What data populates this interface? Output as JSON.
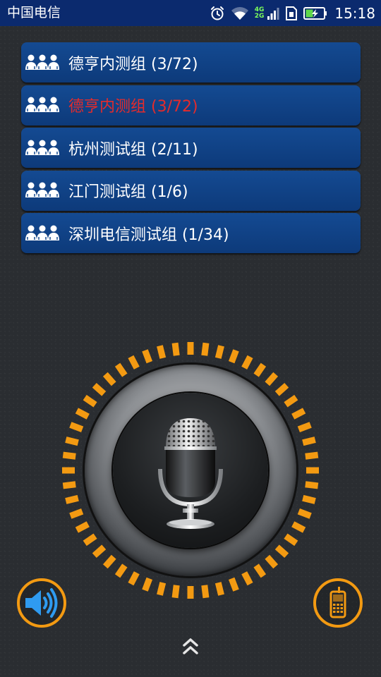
{
  "status_bar": {
    "carrier": "中国电信",
    "network_top": "4G",
    "network_bottom": "2G",
    "time": "15:18",
    "icons": [
      "alarm-icon",
      "wifi-icon",
      "signal-icon",
      "sim-icon",
      "battery-charging-icon"
    ]
  },
  "groups": [
    {
      "label": "德亨内测组 (3/72)",
      "icon": "group-icon",
      "active": false
    },
    {
      "label": "德亨内测组 (3/72)",
      "icon": "group-icon",
      "active": true
    },
    {
      "label": "杭州测试组 (2/11)",
      "icon": "group-icon",
      "active": false
    },
    {
      "label": "江门测试组 (1/6)",
      "icon": "group-icon",
      "active": false
    },
    {
      "label": "深圳电信测试组 (1/34)",
      "icon": "group-icon",
      "active": false
    }
  ],
  "ptt": {
    "icon": "microphone-icon"
  },
  "controls": {
    "speaker_icon": "speaker-icon",
    "phone_icon": "mobile-phone-icon",
    "expand_icon": "double-chevron-up-icon"
  },
  "colors": {
    "status_bar": "#0b2a6e",
    "group_item": "#134a91",
    "active_text": "#e52b2b",
    "accent_orange": "#f39a12",
    "speaker_blue": "#2f9bf0",
    "background": "#2a2d31"
  }
}
